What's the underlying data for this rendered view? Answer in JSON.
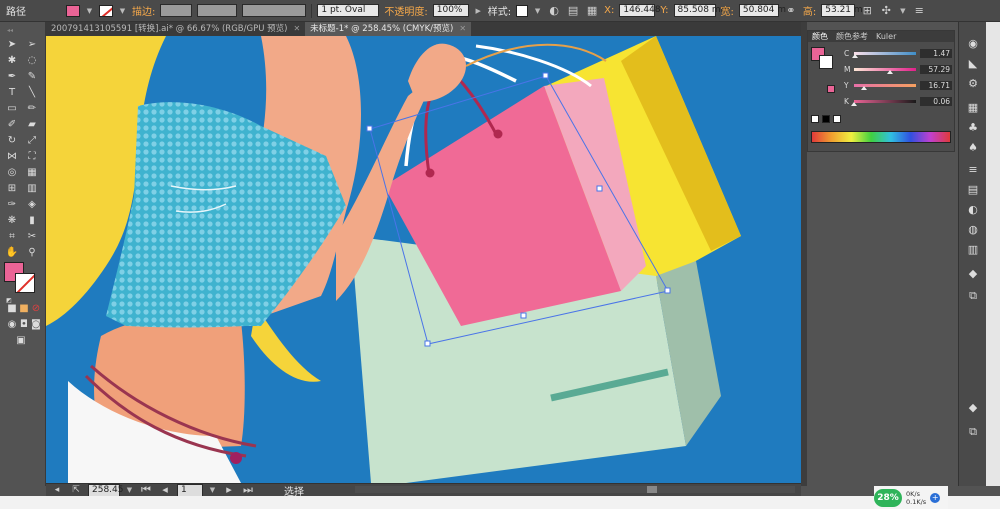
{
  "control_bar": {
    "path_label": "路径",
    "stroke_label": "描边:",
    "stroke_profile": "1 pt. Oval",
    "opacity_label": "不透明度:",
    "opacity_value": "100%",
    "style_label": "样式:",
    "x_label": "X:",
    "x_value": "146.448",
    "y_label": "Y:",
    "y_value": "85.508 mm",
    "w_label": "宽:",
    "w_value": "50.804 m",
    "h_label": "高:",
    "h_value": "53.21 mm"
  },
  "tabs": [
    {
      "label": "200791413105591 [转换].ai* @ 66.67% (RGB/GPU 预览)",
      "active": false
    },
    {
      "label": "未标题-1* @ 258.45% (CMYK/预览)",
      "active": true
    }
  ],
  "color_panel": {
    "tabs": [
      "颜色",
      "颜色参考",
      "Kuler"
    ],
    "channels": [
      {
        "name": "C",
        "value": "1.47",
        "unit": "%",
        "pct": 1.47
      },
      {
        "name": "M",
        "value": "57.29",
        "unit": "%",
        "pct": 57.29
      },
      {
        "name": "Y",
        "value": "16.71",
        "unit": "%",
        "pct": 16.71
      },
      {
        "name": "K",
        "value": "0.06",
        "unit": "%",
        "pct": 0.06
      }
    ]
  },
  "status_bar": {
    "zoom": "258.45",
    "page": "1",
    "tool_status": "选择"
  },
  "network_widget": {
    "percent": "28%",
    "up": "0K/s",
    "down": "0.1K/s"
  },
  "colors": {
    "fill": "#ea6496",
    "canvas": "#1f7bbf",
    "hair": "#f5d43a",
    "blouse": "#3fb3cf",
    "skin": "#f2a988",
    "bag_pink": "#f06a96",
    "bag_yellow": "#f7e432",
    "bag_mint": "#c7e3cd"
  },
  "icons": [
    "selection-tool-icon",
    "direct-selection-tool-icon",
    "pen-tool-icon",
    "type-tool-icon",
    "brush-tool-icon",
    "rotate-tool-icon",
    "hand-tool-icon",
    "zoom-tool-icon"
  ]
}
